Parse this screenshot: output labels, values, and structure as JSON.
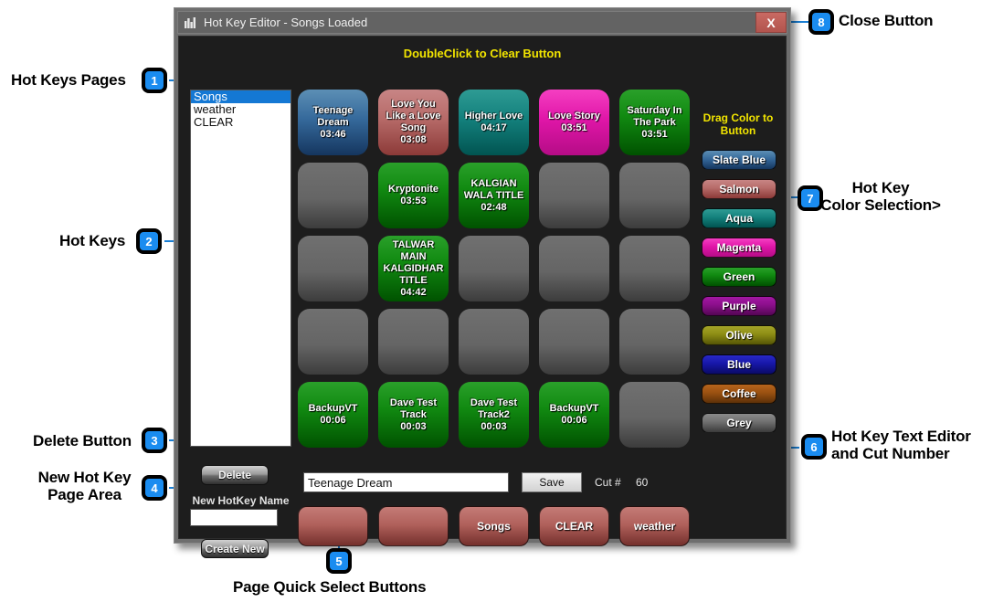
{
  "window": {
    "title": "Hot Key Editor - Songs Loaded",
    "title_icon": "equalizer-icon",
    "close_label": "X",
    "hint": "DoubleClick to Clear Button"
  },
  "pages": {
    "items": [
      {
        "label": "Songs",
        "selected": true
      },
      {
        "label": "weather",
        "selected": false
      },
      {
        "label": "CLEAR",
        "selected": false
      }
    ]
  },
  "controls": {
    "delete_label": "Delete",
    "new_name_label": "New HotKey Name",
    "new_name_value": "",
    "new_name_placeholder": "",
    "create_new_label": "Create New"
  },
  "editor": {
    "name_value": "Teenage Dream",
    "name_placeholder": "",
    "save_label": "Save",
    "cut_label": "Cut #",
    "cut_value": "60"
  },
  "palette": {
    "title": "Drag Color\nto Button",
    "colors": [
      {
        "label": "Slate Blue",
        "css": "c-slateblue",
        "hex": "#35699b"
      },
      {
        "label": "Salmon",
        "css": "c-salmon",
        "hex": "#b66a68"
      },
      {
        "label": "Aqua",
        "css": "c-aqua",
        "hex": "#13807c"
      },
      {
        "label": "Magenta",
        "css": "c-magenta",
        "hex": "#e016a8"
      },
      {
        "label": "Green",
        "css": "c-green",
        "hex": "#118a11"
      },
      {
        "label": "Purple",
        "css": "c-purple",
        "hex": "#8b0f8b"
      },
      {
        "label": "Olive",
        "css": "c-olive",
        "hex": "#8d8d14"
      },
      {
        "label": "Blue",
        "css": "c-blue",
        "hex": "#1717a8"
      },
      {
        "label": "Coffee",
        "css": "c-coffee",
        "hex": "#9a5111"
      },
      {
        "label": "Grey",
        "css": "c-grey",
        "hex": "#6f6f6f"
      }
    ]
  },
  "hotkeys": {
    "rows": 5,
    "cols": 5,
    "buttons": [
      {
        "title": "Teenage Dream",
        "time": "03:46",
        "color": "slateblue"
      },
      {
        "title": "Love You Like a Love Song",
        "time": "03:08",
        "color": "salmon"
      },
      {
        "title": "Higher Love",
        "time": "04:17",
        "color": "aqua"
      },
      {
        "title": "Love Story",
        "time": "03:51",
        "color": "magenta"
      },
      {
        "title": "Saturday In The Park",
        "time": "03:51",
        "color": "green"
      },
      {
        "title": "",
        "time": "",
        "color": "empty"
      },
      {
        "title": "Kryptonite",
        "time": "03:53",
        "color": "green"
      },
      {
        "title": "KALGIAN WALA TITLE",
        "time": "02:48",
        "color": "green"
      },
      {
        "title": "",
        "time": "",
        "color": "empty"
      },
      {
        "title": "",
        "time": "",
        "color": "empty"
      },
      {
        "title": "",
        "time": "",
        "color": "empty"
      },
      {
        "title": "TALWAR MAIN KALGIDHAR TITLE",
        "time": "04:42",
        "color": "green"
      },
      {
        "title": "",
        "time": "",
        "color": "empty"
      },
      {
        "title": "",
        "time": "",
        "color": "empty"
      },
      {
        "title": "",
        "time": "",
        "color": "empty"
      },
      {
        "title": "",
        "time": "",
        "color": "empty"
      },
      {
        "title": "",
        "time": "",
        "color": "empty"
      },
      {
        "title": "",
        "time": "",
        "color": "empty"
      },
      {
        "title": "",
        "time": "",
        "color": "empty"
      },
      {
        "title": "",
        "time": "",
        "color": "empty"
      },
      {
        "title": "BackupVT",
        "time": "00:06",
        "color": "green"
      },
      {
        "title": "Dave Test Track",
        "time": "00:03",
        "color": "green"
      },
      {
        "title": "Dave Test Track2",
        "time": "00:03",
        "color": "green"
      },
      {
        "title": "BackupVT",
        "time": "00:06",
        "color": "green"
      },
      {
        "title": "",
        "time": "",
        "color": "empty"
      }
    ]
  },
  "quick_select": {
    "buttons": [
      {
        "label": ""
      },
      {
        "label": ""
      },
      {
        "label": "Songs"
      },
      {
        "label": "CLEAR"
      },
      {
        "label": "weather"
      }
    ]
  },
  "annotations": {
    "accent": "#1a8cf0",
    "items": [
      {
        "num": "1",
        "text": "Hot Keys Pages"
      },
      {
        "num": "2",
        "text": "Hot Keys"
      },
      {
        "num": "3",
        "text": "Delete Button"
      },
      {
        "num": "4",
        "text": "New Hot Key\nPage Area"
      },
      {
        "num": "5",
        "text": "Page Quick Select Buttons"
      },
      {
        "num": "6",
        "text": "Hot Key Text Editor\nand Cut Number"
      },
      {
        "num": "7",
        "text": "Hot Key\nColor Selection>"
      },
      {
        "num": "8",
        "text": "Close Button"
      }
    ]
  }
}
